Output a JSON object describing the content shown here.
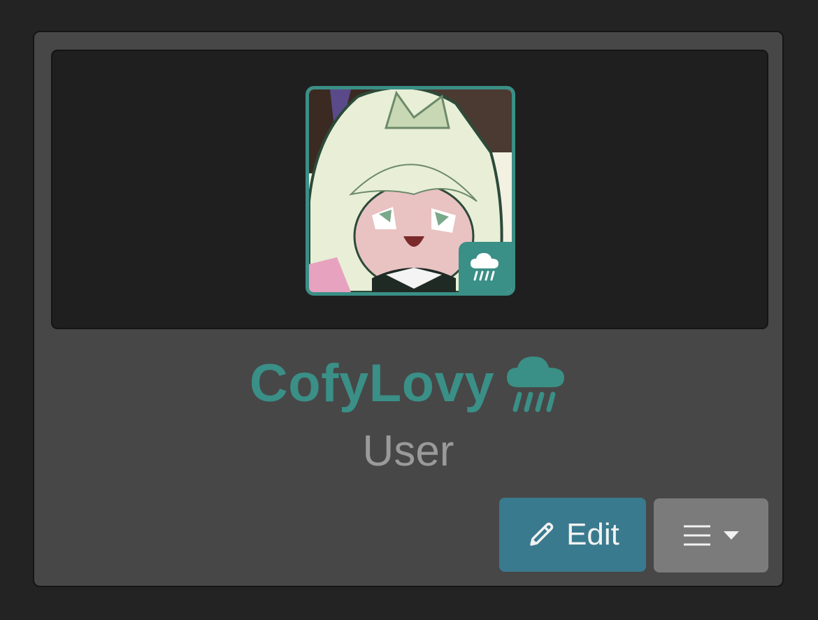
{
  "profile": {
    "username": "CofyLovy",
    "role": "User",
    "status_icon": "rain-cloud-icon"
  },
  "actions": {
    "edit_label": "Edit",
    "edit_icon": "pencil-icon",
    "menu_icon": "hamburger-menu-icon",
    "menu_dropdown_icon": "caret-down-icon"
  },
  "colors": {
    "accent": "#3a8f86",
    "edit_button": "#3a7a8e",
    "menu_button": "#7b7b7b",
    "card_background": "#474747",
    "page_background": "#232323"
  }
}
